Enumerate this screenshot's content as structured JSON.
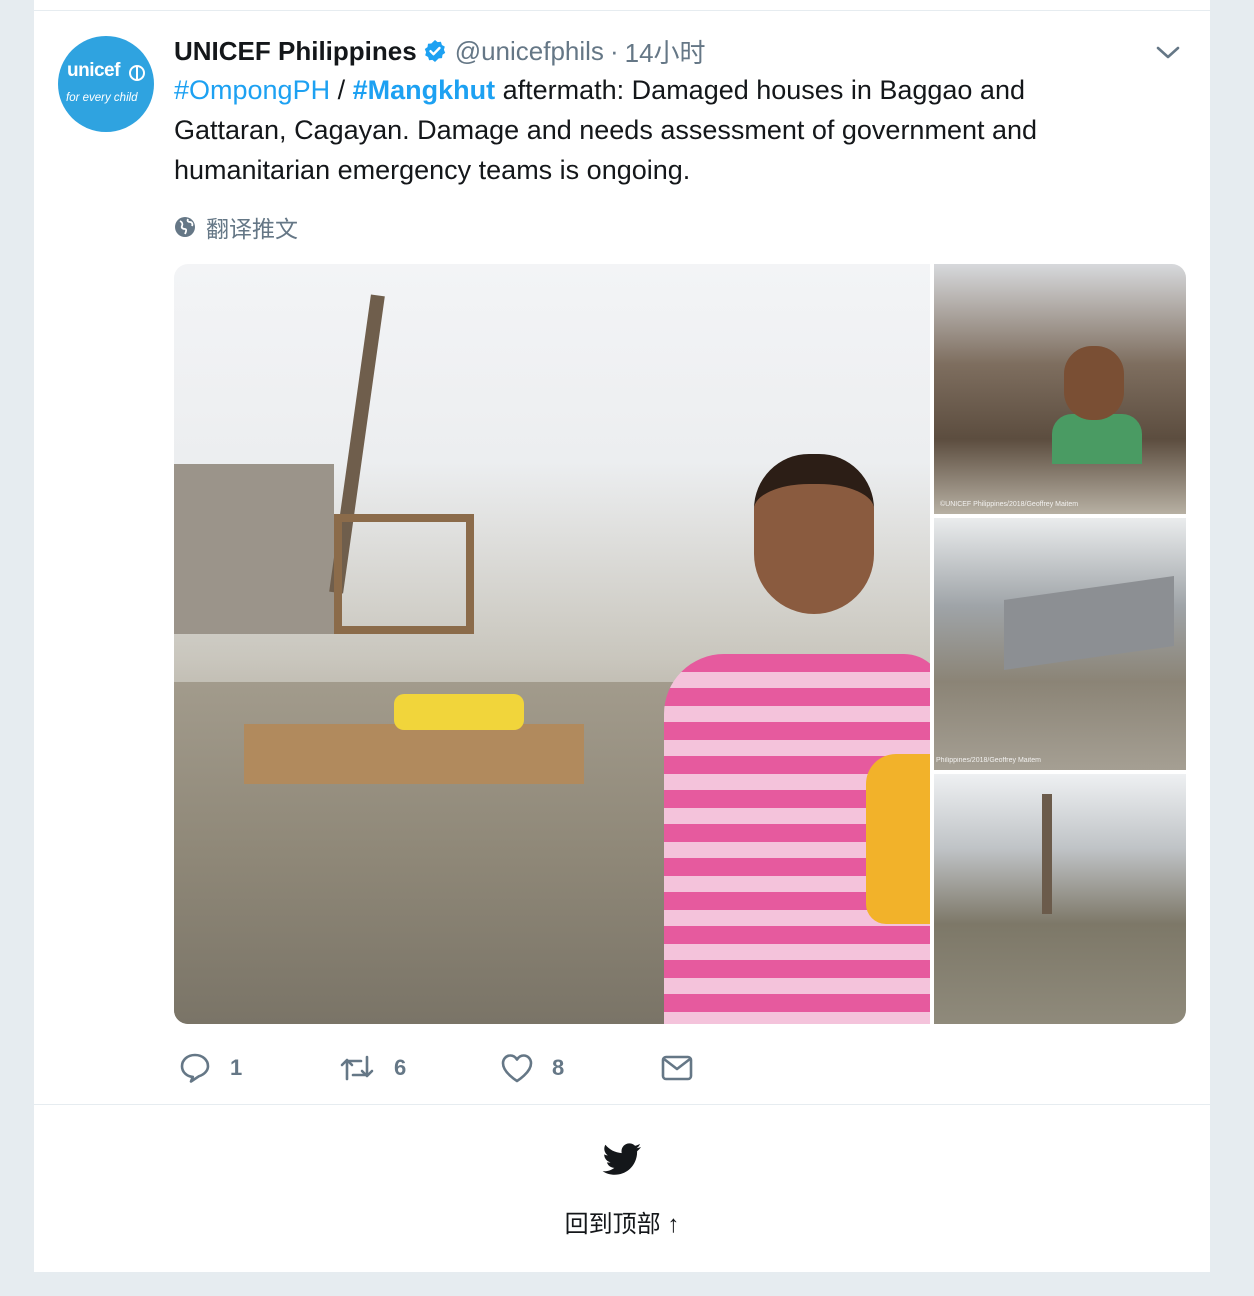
{
  "tweet": {
    "avatar": {
      "brand": "unicef",
      "tagline": "for every child"
    },
    "display_name": "UNICEF Philippines",
    "handle": "@unicefphils",
    "separator": "·",
    "time": "14小时",
    "text": {
      "hashtag1": "#OmpongPH",
      "slash": " / ",
      "hashtag2": "#Mangkhut",
      "body": " aftermath: Damaged houses in Baggao and Gattaran, Cagayan. Damage and needs assessment of government and humanitarian emergency teams is ongoing."
    },
    "translate_label": "翻译推文",
    "photos": {
      "watermark1": "©UNICEF Philippines/2018/Geoffrey Maitem",
      "watermark2": "Philippines/2018/Geoffrey Maitem"
    },
    "actions": {
      "reply_count": "1",
      "retweet_count": "6",
      "like_count": "8"
    }
  },
  "footer": {
    "back_to_top": "回到顶部 ↑"
  },
  "colors": {
    "accent": "#1da1f2",
    "muted": "#657786",
    "background": "#e6ecf0",
    "avatar": "#2fa3e0"
  },
  "icons": {
    "verified": "verified-badge-icon",
    "caret": "chevron-down-icon",
    "globe": "globe-icon",
    "reply": "reply-icon",
    "retweet": "retweet-icon",
    "like": "heart-icon",
    "dm": "envelope-icon",
    "bird": "twitter-bird-icon"
  }
}
